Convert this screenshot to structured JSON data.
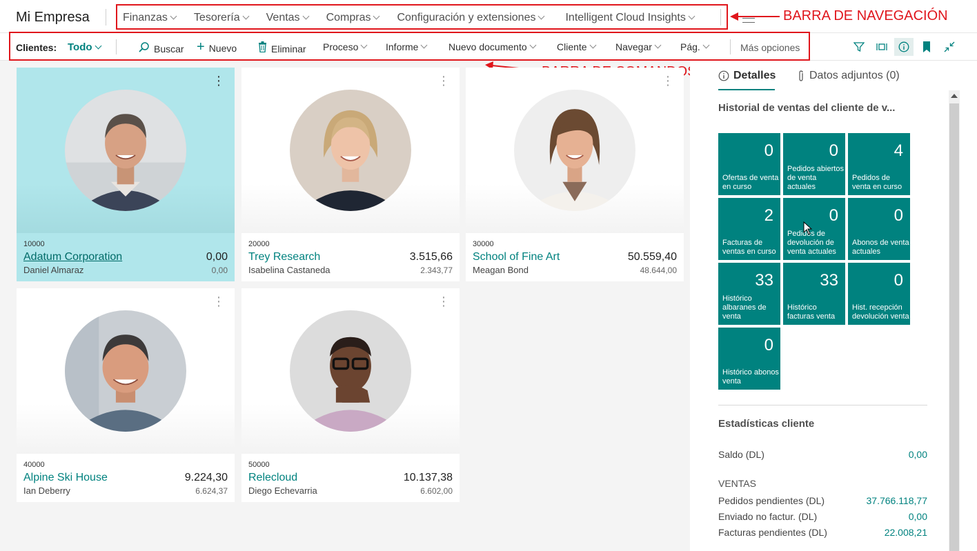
{
  "navbar": {
    "app_title": "Mi Empresa",
    "items": [
      "Finanzas",
      "Tesorería",
      "Ventas",
      "Compras",
      "Configuración y extensiones",
      "Intelligent Cloud Insights"
    ]
  },
  "annotations": {
    "nav_label": "BARRA DE NAVEGACIÓN",
    "cmd_label": "BARRA DE COMANDOS",
    "color": "#e0161c"
  },
  "commandbar": {
    "label": "Clientes:",
    "view": "Todo",
    "search": "Buscar",
    "new": "Nuevo",
    "delete": "Eliminar",
    "menus": [
      "Proceso",
      "Informe",
      "Nuevo documento",
      "Cliente",
      "Navegar",
      "Pág."
    ],
    "more": "Más opciones",
    "icons": [
      "filter-icon",
      "list-view-icon",
      "info-icon",
      "bookmark-icon",
      "collapse-icon"
    ]
  },
  "customers": [
    {
      "no": "10000",
      "name": "Adatum Corporation",
      "balance": "0,00",
      "contact": "Daniel Almaraz",
      "balance_due": "0,00",
      "selected": true
    },
    {
      "no": "20000",
      "name": "Trey Research",
      "balance": "3.515,66",
      "contact": "Isabelina Castaneda",
      "balance_due": "2.343,77",
      "selected": false
    },
    {
      "no": "30000",
      "name": "School of Fine Art",
      "balance": "50.559,40",
      "contact": "Meagan Bond",
      "balance_due": "48.644,00",
      "selected": false
    },
    {
      "no": "40000",
      "name": "Alpine Ski House",
      "balance": "9.224,30",
      "contact": "Ian Deberry",
      "balance_due": "6.624,37",
      "selected": false
    },
    {
      "no": "50000",
      "name": "Relecloud",
      "balance": "10.137,38",
      "contact": "Diego Echevarria",
      "balance_due": "6.602,00",
      "selected": false
    }
  ],
  "factbox": {
    "tabs": {
      "details": "Detalles",
      "attachments": "Datos adjuntos (0)"
    },
    "history_title": "Historial de ventas del cliente de v...",
    "tiles": [
      {
        "value": "0",
        "label": "Ofertas de venta en curso"
      },
      {
        "value": "0",
        "label": "Pedidos abiertos de venta actuales"
      },
      {
        "value": "4",
        "label": "Pedidos de venta en curso"
      },
      {
        "value": "2",
        "label": "Facturas de ventas en curso"
      },
      {
        "value": "0",
        "label": "Pedidos de devolución de venta actuales"
      },
      {
        "value": "0",
        "label": "Abonos de venta actuales"
      },
      {
        "value": "33",
        "label": "Histórico albaranes de venta"
      },
      {
        "value": "33",
        "label": "Histórico facturas venta"
      },
      {
        "value": "0",
        "label": "Hist. recepción devolución venta"
      },
      {
        "value": "0",
        "label": "Histórico abonos venta"
      }
    ],
    "stats_title": "Estadísticas cliente",
    "saldo_label": "Saldo (DL)",
    "saldo_value": "0,00",
    "ventas_title": "VENTAS",
    "ventas_rows": [
      {
        "label": "Pedidos pendientes (DL)",
        "value": "37.766.118,77"
      },
      {
        "label": "Enviado no factur. (DL)",
        "value": "0,00"
      },
      {
        "label": "Facturas pendientes (DL)",
        "value": "22.008,21"
      }
    ]
  },
  "colors": {
    "accent": "#00827f",
    "selected_card": "#b0e6eb",
    "tile": "#00827f"
  }
}
